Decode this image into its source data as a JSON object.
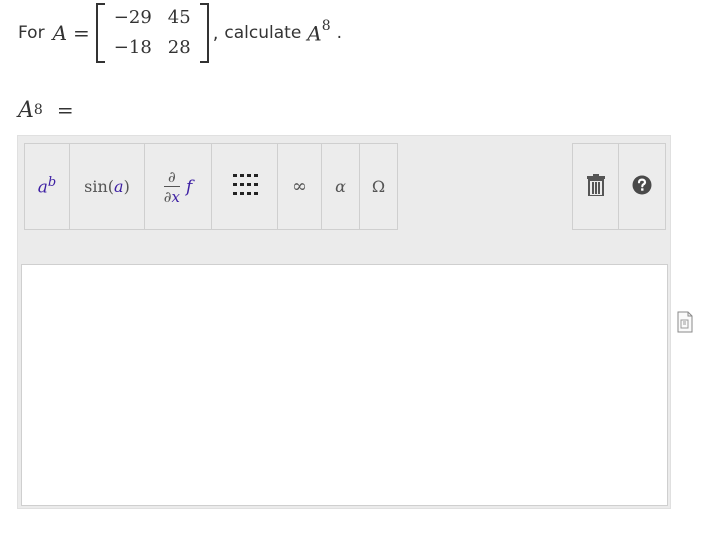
{
  "question": {
    "prefix": "For",
    "var": "A",
    "equals": "=",
    "matrix": [
      [
        "−29",
        "45"
      ],
      [
        "−18",
        "28"
      ]
    ],
    "comma": ",",
    "calc_text": "calculate",
    "power_base": "A",
    "power_exp": "8",
    "period": "."
  },
  "answer_lhs": {
    "base": "A",
    "exp": "8",
    "equals": "="
  },
  "toolbar": {
    "power": {
      "base": "a",
      "exp": "b"
    },
    "sin": {
      "fn": "sin",
      "arg": "a"
    },
    "partial": {
      "num": "∂",
      "den": "∂",
      "den_var": "x",
      "func": "f"
    },
    "infinity": "∞",
    "alpha": "α",
    "omega": "Ω"
  },
  "colors": {
    "accent_purple": "#3d1fa3",
    "panel_bg": "#ebebeb",
    "border": "#cfcfcf",
    "text": "#333333"
  },
  "icons": [
    "matrix-icon",
    "trash-icon",
    "help-icon",
    "document-icon"
  ]
}
